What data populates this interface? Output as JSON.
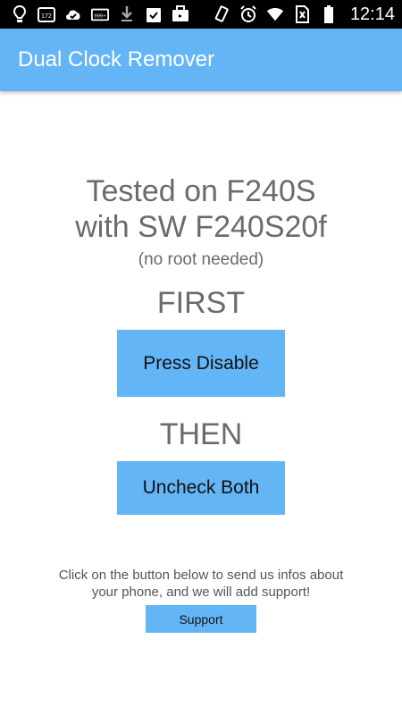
{
  "status_bar": {
    "left_icons": [
      "location-pin-icon",
      "calendar-172-icon",
      "check-badge-icon",
      "email-999-icon",
      "download-icon",
      "clipboard-check-icon",
      "briefcase-icon"
    ],
    "calendar_badge": "172",
    "email_badge": "999+",
    "right_icons": [
      "vibrate-icon",
      "alarm-icon",
      "wifi-icon",
      "no-sim-icon",
      "battery-icon"
    ],
    "time": "12:14"
  },
  "app_bar": {
    "title": "Dual Clock Remover",
    "color": "#64b5f6"
  },
  "main": {
    "tested_line1": "Tested on F240S",
    "tested_line2": "with SW F240S20f",
    "no_root": "(no root needed)",
    "first_label": "FIRST",
    "disable_button_label": "Press Disable",
    "then_label": "THEN",
    "uncheck_button_label": "Uncheck Both",
    "support_text_line1": "Click on the button below to send us infos about",
    "support_text_line2": "your phone, and we will add support!",
    "support_button_label": "Support"
  }
}
